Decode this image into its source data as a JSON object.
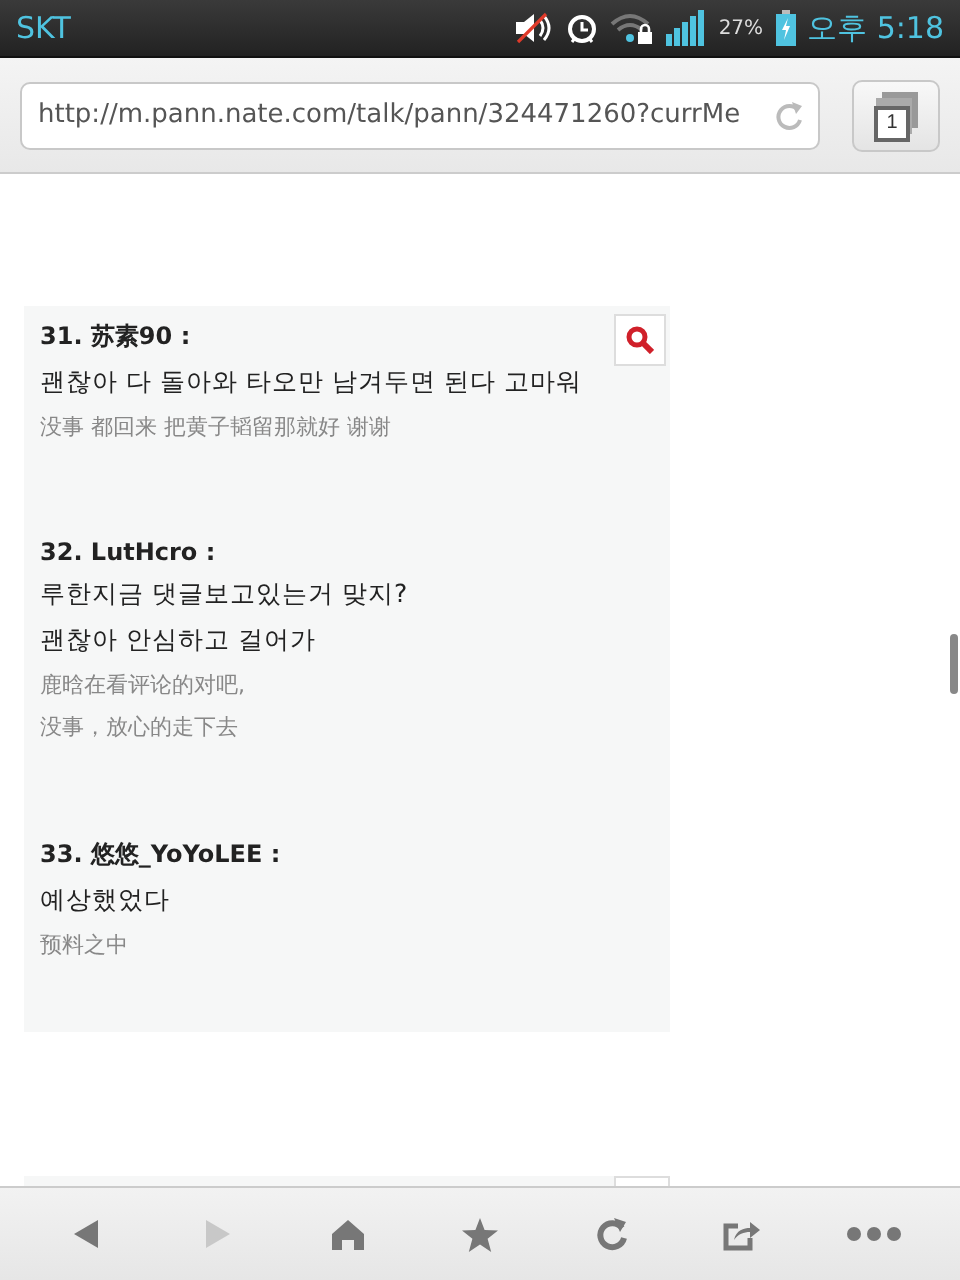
{
  "status_bar": {
    "carrier": "SKT",
    "battery": "27%",
    "time": "오후 5:18"
  },
  "address_bar": {
    "url": "http://m.pann.nate.com/talk/pann/324471260?currMe",
    "tab_count": "1"
  },
  "comments": [
    {
      "header": "31. 苏素90 :",
      "korean": [
        "괜찮아 다 돌아와 타오만 남겨두면 된다 고마워"
      ],
      "chinese": [
        "没事 都回来 把黄子韬留那就好 谢谢"
      ]
    },
    {
      "header": "32. LutHcro :",
      "korean": [
        "루한지금 댓글보고있는거 맞지?",
        "괜찮아 안심하고 걸어가"
      ],
      "chinese": [
        "鹿晗在看评论的对吧,",
        "没事，放心的走下去"
      ]
    },
    {
      "header": "33. 悠悠_YoYoLEE :",
      "korean": [
        "예상했었다"
      ],
      "chinese": [
        "预料之中"
      ]
    }
  ],
  "toolbar": [
    {
      "kind": "back",
      "disabled": false
    },
    {
      "kind": "forward",
      "disabled": true
    },
    {
      "kind": "home",
      "disabled": false
    },
    {
      "kind": "bookmark",
      "disabled": false
    },
    {
      "kind": "reload",
      "disabled": false
    },
    {
      "kind": "share",
      "disabled": false
    },
    {
      "kind": "more",
      "disabled": false
    }
  ]
}
